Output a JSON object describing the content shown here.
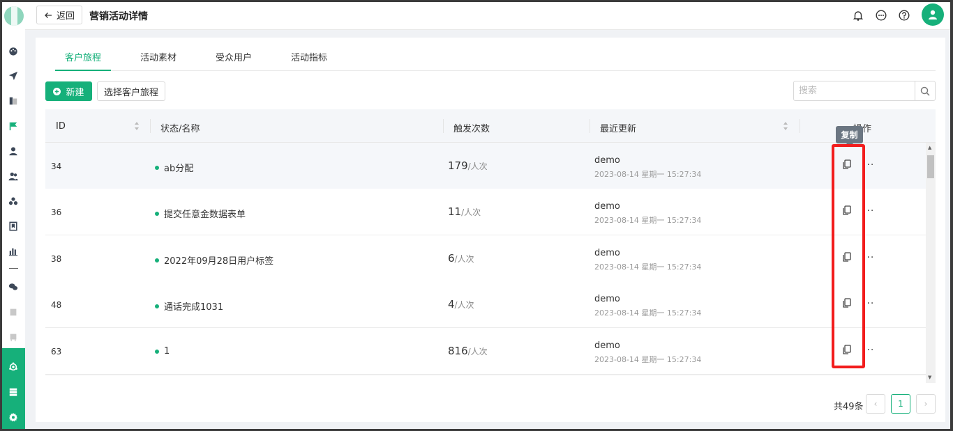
{
  "header": {
    "back_label": "返回",
    "title": "营销活动详情"
  },
  "tabs": [
    {
      "label": "客户旅程",
      "active": true
    },
    {
      "label": "活动素材",
      "active": false
    },
    {
      "label": "受众用户",
      "active": false
    },
    {
      "label": "活动指标",
      "active": false
    }
  ],
  "toolbar": {
    "new_label": "新建",
    "select_label": "选择客户旅程",
    "search_placeholder": "搜索"
  },
  "table": {
    "columns": [
      "ID",
      "状态/名称",
      "触发次数",
      "最近更新",
      "操作"
    ],
    "rows": [
      {
        "id": "34",
        "name": "ab分配",
        "count": "179",
        "unit": "/人次",
        "updated_by": "demo",
        "updated_at": "2023-08-14 星期一 15:27:34"
      },
      {
        "id": "36",
        "name": "提交任意金数据表单",
        "count": "11",
        "unit": "/人次",
        "updated_by": "demo",
        "updated_at": "2023-08-14 星期一 15:27:34"
      },
      {
        "id": "38",
        "name": "2022年09月28日用户标签",
        "count": "6",
        "unit": "/人次",
        "updated_by": "demo",
        "updated_at": "2023-08-14 星期一 15:27:34"
      },
      {
        "id": "48",
        "name": "通话完成1031",
        "count": "4",
        "unit": "/人次",
        "updated_by": "demo",
        "updated_at": "2023-08-14 星期一 15:27:34"
      },
      {
        "id": "63",
        "name": "1",
        "count": "816",
        "unit": "/人次",
        "updated_by": "demo",
        "updated_at": "2023-08-14 星期一 15:27:34"
      }
    ],
    "more_glyph": "···"
  },
  "tooltip": {
    "text": "复制"
  },
  "pagination": {
    "total_label": "共49条",
    "current_page": "1",
    "prev_glyph": "‹",
    "next_glyph": "›"
  },
  "colors": {
    "accent": "#16b07a",
    "highlight": "#f21d1d"
  },
  "icons": {
    "sidebar": [
      "dashboard-icon",
      "send-icon",
      "document-icon",
      "flag-icon",
      "user-icon",
      "users-icon",
      "group-icon",
      "bookmark-icon",
      "bar-chart-icon",
      "wechat-icon",
      "file-icon",
      "device-icon"
    ],
    "sidebar_bottom": [
      "hub-icon",
      "server-icon",
      "gear-icon"
    ]
  }
}
